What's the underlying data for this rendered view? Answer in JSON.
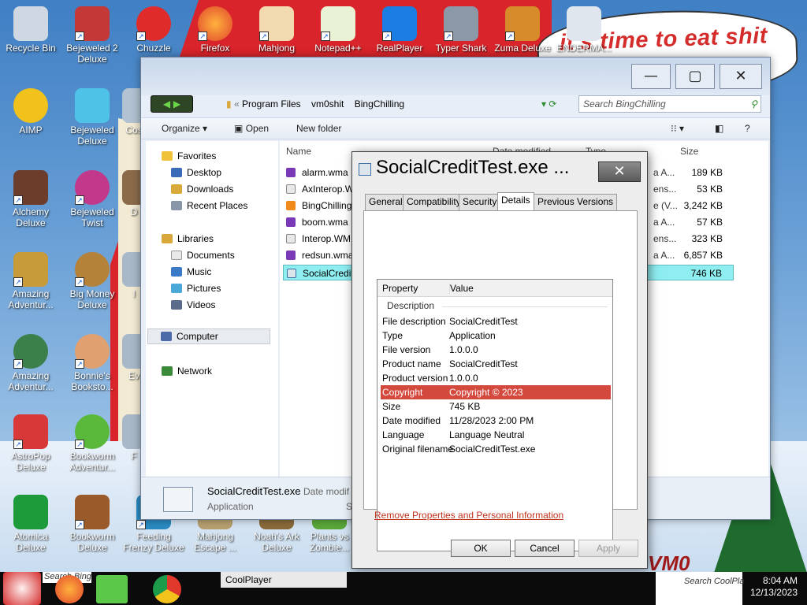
{
  "desktop": {
    "banner_text": "it's time to eat shit",
    "watermark_text": "VM0",
    "icons": [
      {
        "label": "Recycle Bin"
      },
      {
        "label": "Bejeweled 2 Deluxe"
      },
      {
        "label": "Chuzzle"
      },
      {
        "label": "Firefox"
      },
      {
        "label": "Mahjong"
      },
      {
        "label": "Notepad++"
      },
      {
        "label": "RealPlayer"
      },
      {
        "label": "Typer Shark"
      },
      {
        "label": "Zuma Deluxe"
      },
      {
        "label": "ENDERMA..."
      },
      {
        "label": "AIMP"
      },
      {
        "label": "Bejeweled Deluxe"
      },
      {
        "label": "Cos"
      },
      {
        "label": "Alchemy Deluxe"
      },
      {
        "label": "Bejeweled Twist"
      },
      {
        "label": "D"
      },
      {
        "label": "Amazing Adventur..."
      },
      {
        "label": "Big Money Deluxe"
      },
      {
        "label": "I"
      },
      {
        "label": "Amazing Adventur..."
      },
      {
        "label": "Bonnie's Booksto..."
      },
      {
        "label": "Ev"
      },
      {
        "label": "AstroPop Deluxe"
      },
      {
        "label": "Bookworm Adventur..."
      },
      {
        "label": "F"
      },
      {
        "label": "Atomica Deluxe"
      },
      {
        "label": "Bookworm Deluxe"
      },
      {
        "label": "Feeding Frenzy Deluxe"
      },
      {
        "label": "Mahjong Escape ..."
      },
      {
        "label": "Noah's Ark Deluxe"
      },
      {
        "label": "Plants vs Zombie..."
      }
    ]
  },
  "explorer": {
    "breadcrumb": [
      "Program Files",
      "vm0shit",
      "BingChilling"
    ],
    "search_placeholder": "Search BingChilling",
    "toolbar": {
      "organize": "Organize",
      "open": "Open",
      "new_folder": "New folder"
    },
    "nav": {
      "favorites": "Favorites",
      "desktop": "Desktop",
      "downloads": "Downloads",
      "recent": "Recent Places",
      "libraries": "Libraries",
      "documents": "Documents",
      "music": "Music",
      "pictures": "Pictures",
      "videos": "Videos",
      "computer": "Computer",
      "network": "Network"
    },
    "columns": {
      "name": "Name",
      "date": "Date modified",
      "type": "Type",
      "size": "Size"
    },
    "files": [
      {
        "name": "alarm.wma",
        "type": "a A...",
        "size": "189 KB"
      },
      {
        "name": "AxInterop.W",
        "type": "ens...",
        "size": "53 KB"
      },
      {
        "name": "BingChilling",
        "type": "e (V...",
        "size": "3,242 KB"
      },
      {
        "name": "boom.wma",
        "type": "a A...",
        "size": "57 KB"
      },
      {
        "name": "Interop.WM",
        "type": "ens...",
        "size": "323 KB"
      },
      {
        "name": "redsun.wma",
        "type": "a A...",
        "size": "6,857 KB"
      },
      {
        "name": "SocialCredit",
        "type": "",
        "size": "746 KB"
      }
    ],
    "details": {
      "name": "SocialCreditTest.exe",
      "date_label": "Date modif",
      "type": "Application",
      "extra": "S"
    }
  },
  "props": {
    "title": "SocialCreditTest.exe ...",
    "tabs": [
      "General",
      "Compatibility",
      "Security",
      "Details",
      "Previous Versions"
    ],
    "header": {
      "property": "Property",
      "value": "Value"
    },
    "section": "Description",
    "rows": [
      {
        "k": "File description",
        "v": "SocialCreditTest"
      },
      {
        "k": "Type",
        "v": "Application"
      },
      {
        "k": "File version",
        "v": "1.0.0.0"
      },
      {
        "k": "Product name",
        "v": "SocialCreditTest"
      },
      {
        "k": "Product version",
        "v": "1.0.0.0"
      },
      {
        "k": "Copyright",
        "v": "Copyright ©  2023"
      },
      {
        "k": "Size",
        "v": "745 KB"
      },
      {
        "k": "Date modified",
        "v": "11/28/2023 2:00 PM"
      },
      {
        "k": "Language",
        "v": "Language Neutral"
      },
      {
        "k": "Original filename",
        "v": "SocialCreditTest.exe"
      }
    ],
    "remove_link": "Remove Properties and Personal Information",
    "ok": "OK",
    "cancel": "Cancel",
    "apply": "Apply"
  },
  "taskbar": {
    "search_text": "Search  Bing",
    "coolplayer": "CoolPlayer",
    "search_right": "Search CoolPla",
    "time": "8:04 AM",
    "date": "12/13/2023"
  }
}
